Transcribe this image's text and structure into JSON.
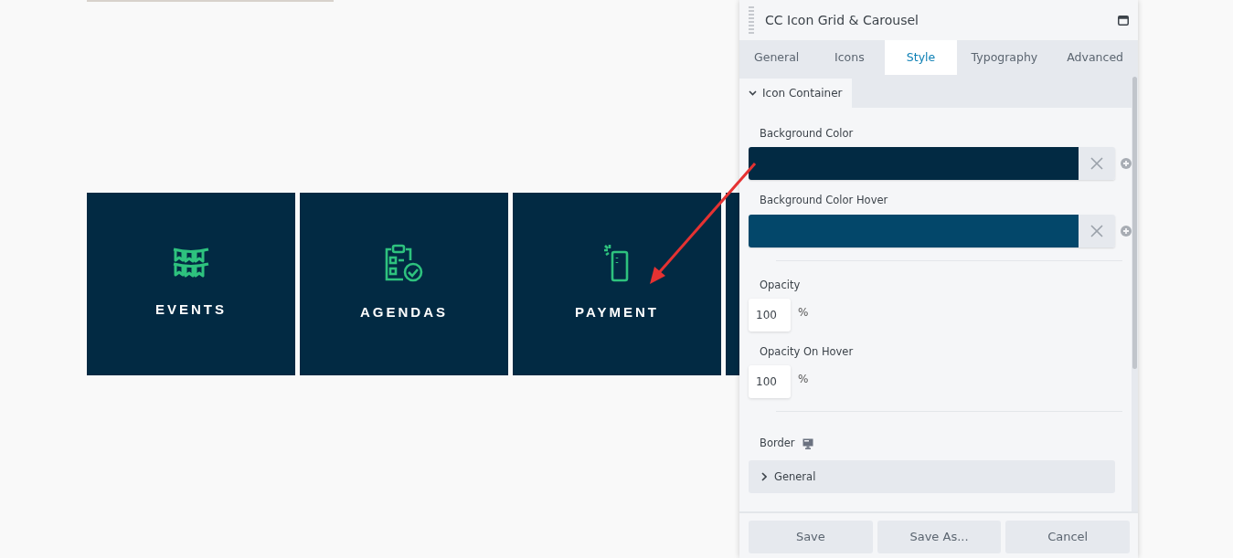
{
  "tiles": [
    {
      "kind": "tile",
      "label": "EVENTS"
    },
    {
      "kind": "tile",
      "label": "AGENDAS"
    },
    {
      "kind": "tile",
      "label": "PAYMENT"
    },
    {
      "kind": "cut-off"
    }
  ],
  "panel": {
    "title": "CC Icon Grid & Carousel",
    "tabs": [
      {
        "label": "General",
        "selected": false
      },
      {
        "label": "Icons",
        "selected": false
      },
      {
        "label": "Style",
        "selected": true
      },
      {
        "label": "Typography",
        "selected": false
      },
      {
        "label": "Advanced",
        "selected": false
      }
    ],
    "section": {
      "label": "Icon Container",
      "expanded": true
    },
    "colors": [
      {
        "label": "Background Color",
        "color": "#022a43"
      },
      {
        "label": "Background Color Hover",
        "color": "#03476a"
      }
    ],
    "opacity": [
      {
        "label": "Opacity",
        "value": "100",
        "unit": "%"
      },
      {
        "label": "Opacity On Hover",
        "value": "100",
        "unit": "%"
      }
    ],
    "border": {
      "label": "Border",
      "group": {
        "label": "General",
        "expanded": false
      }
    },
    "buttons": [
      "Save",
      "Save As...",
      "Cancel"
    ]
  }
}
